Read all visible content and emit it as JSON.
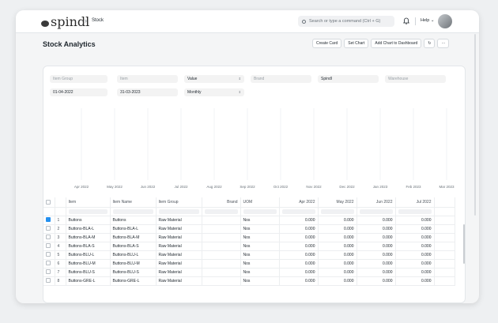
{
  "nav": {
    "brand": "spindl",
    "breadcrumb_sep": "›",
    "breadcrumb": "Stock",
    "search_placeholder": "Search or type a command (Ctrl + G)",
    "help": "Help ⌄"
  },
  "page": {
    "title": "Stock Analytics",
    "actions": [
      "Create Card",
      "Set Chart",
      "Add Chart to Dashboard"
    ],
    "refresh": "↻",
    "more": "···"
  },
  "filters": {
    "item_group": "Item Group",
    "item": "Item",
    "value_type": "Value",
    "brand": "Brand",
    "company": "Spindl",
    "warehouse": "Warehouse",
    "from_date": "01-04-2022",
    "to_date": "31-03-2023",
    "range": "Monthly"
  },
  "chart_data": {
    "type": "line",
    "categories": [
      "Apr 2022",
      "May 2022",
      "Jun 2022",
      "Jul 2022",
      "Aug 2022",
      "Sep 2022",
      "Oct 2022",
      "Nov 2022",
      "Dec 2022",
      "Jan 2023",
      "Feb 2023",
      "Mar 2023"
    ],
    "series": [],
    "grid": "vertical"
  },
  "table": {
    "columns": [
      "Item",
      "Item Name",
      "Item Group",
      "Brand",
      "UOM",
      "Apr 2022",
      "May 2022",
      "Jun 2022",
      "Jul 2022"
    ],
    "rows": [
      {
        "n": "1",
        "item": "Buttons",
        "name": "Buttons",
        "group": "Raw Material",
        "brand": "",
        "uom": "Nos",
        "v1": "0.000",
        "v2": "0.000",
        "v3": "0.000",
        "v4": "0.000",
        "checked": true
      },
      {
        "n": "2",
        "item": "Buttons-BLA-L",
        "name": "Buttons-BLA-L",
        "group": "Raw Material",
        "brand": "",
        "uom": "Nos",
        "v1": "0.000",
        "v2": "0.000",
        "v3": "0.000",
        "v4": "0.000",
        "checked": false
      },
      {
        "n": "3",
        "item": "Buttons-BLA-M",
        "name": "Buttons-BLA-M",
        "group": "Raw Material",
        "brand": "",
        "uom": "Nos",
        "v1": "0.000",
        "v2": "0.000",
        "v3": "0.000",
        "v4": "0.000",
        "checked": false
      },
      {
        "n": "4",
        "item": "Buttons-BLA-S",
        "name": "Buttons-BLA-S",
        "group": "Raw Material",
        "brand": "",
        "uom": "Nos",
        "v1": "0.000",
        "v2": "0.000",
        "v3": "0.000",
        "v4": "0.000",
        "checked": false
      },
      {
        "n": "5",
        "item": "Buttons-BLU-L",
        "name": "Buttons-BLU-L",
        "group": "Raw Material",
        "brand": "",
        "uom": "Nos",
        "v1": "0.000",
        "v2": "0.000",
        "v3": "0.000",
        "v4": "0.000",
        "checked": false
      },
      {
        "n": "6",
        "item": "Buttons-BLU-M",
        "name": "Buttons-BLU-M",
        "group": "Raw Material",
        "brand": "",
        "uom": "Nos",
        "v1": "0.000",
        "v2": "0.000",
        "v3": "0.000",
        "v4": "0.000",
        "checked": false
      },
      {
        "n": "7",
        "item": "Buttons-BLU-S",
        "name": "Buttons-BLU-S",
        "group": "Raw Material",
        "brand": "",
        "uom": "Nos",
        "v1": "0.000",
        "v2": "0.000",
        "v3": "0.000",
        "v4": "0.000",
        "checked": false
      },
      {
        "n": "8",
        "item": "Buttons-GRE-L",
        "name": "Buttons-GRE-L",
        "group": "Raw Material",
        "brand": "",
        "uom": "Nos",
        "v1": "0.000",
        "v2": "0.000",
        "v3": "0.000",
        "v4": "0.000",
        "checked": false
      }
    ]
  },
  "colors": {
    "accent": "#2490ef",
    "card_bg": "#ffffff",
    "page_bg": "#f4f5f6"
  }
}
